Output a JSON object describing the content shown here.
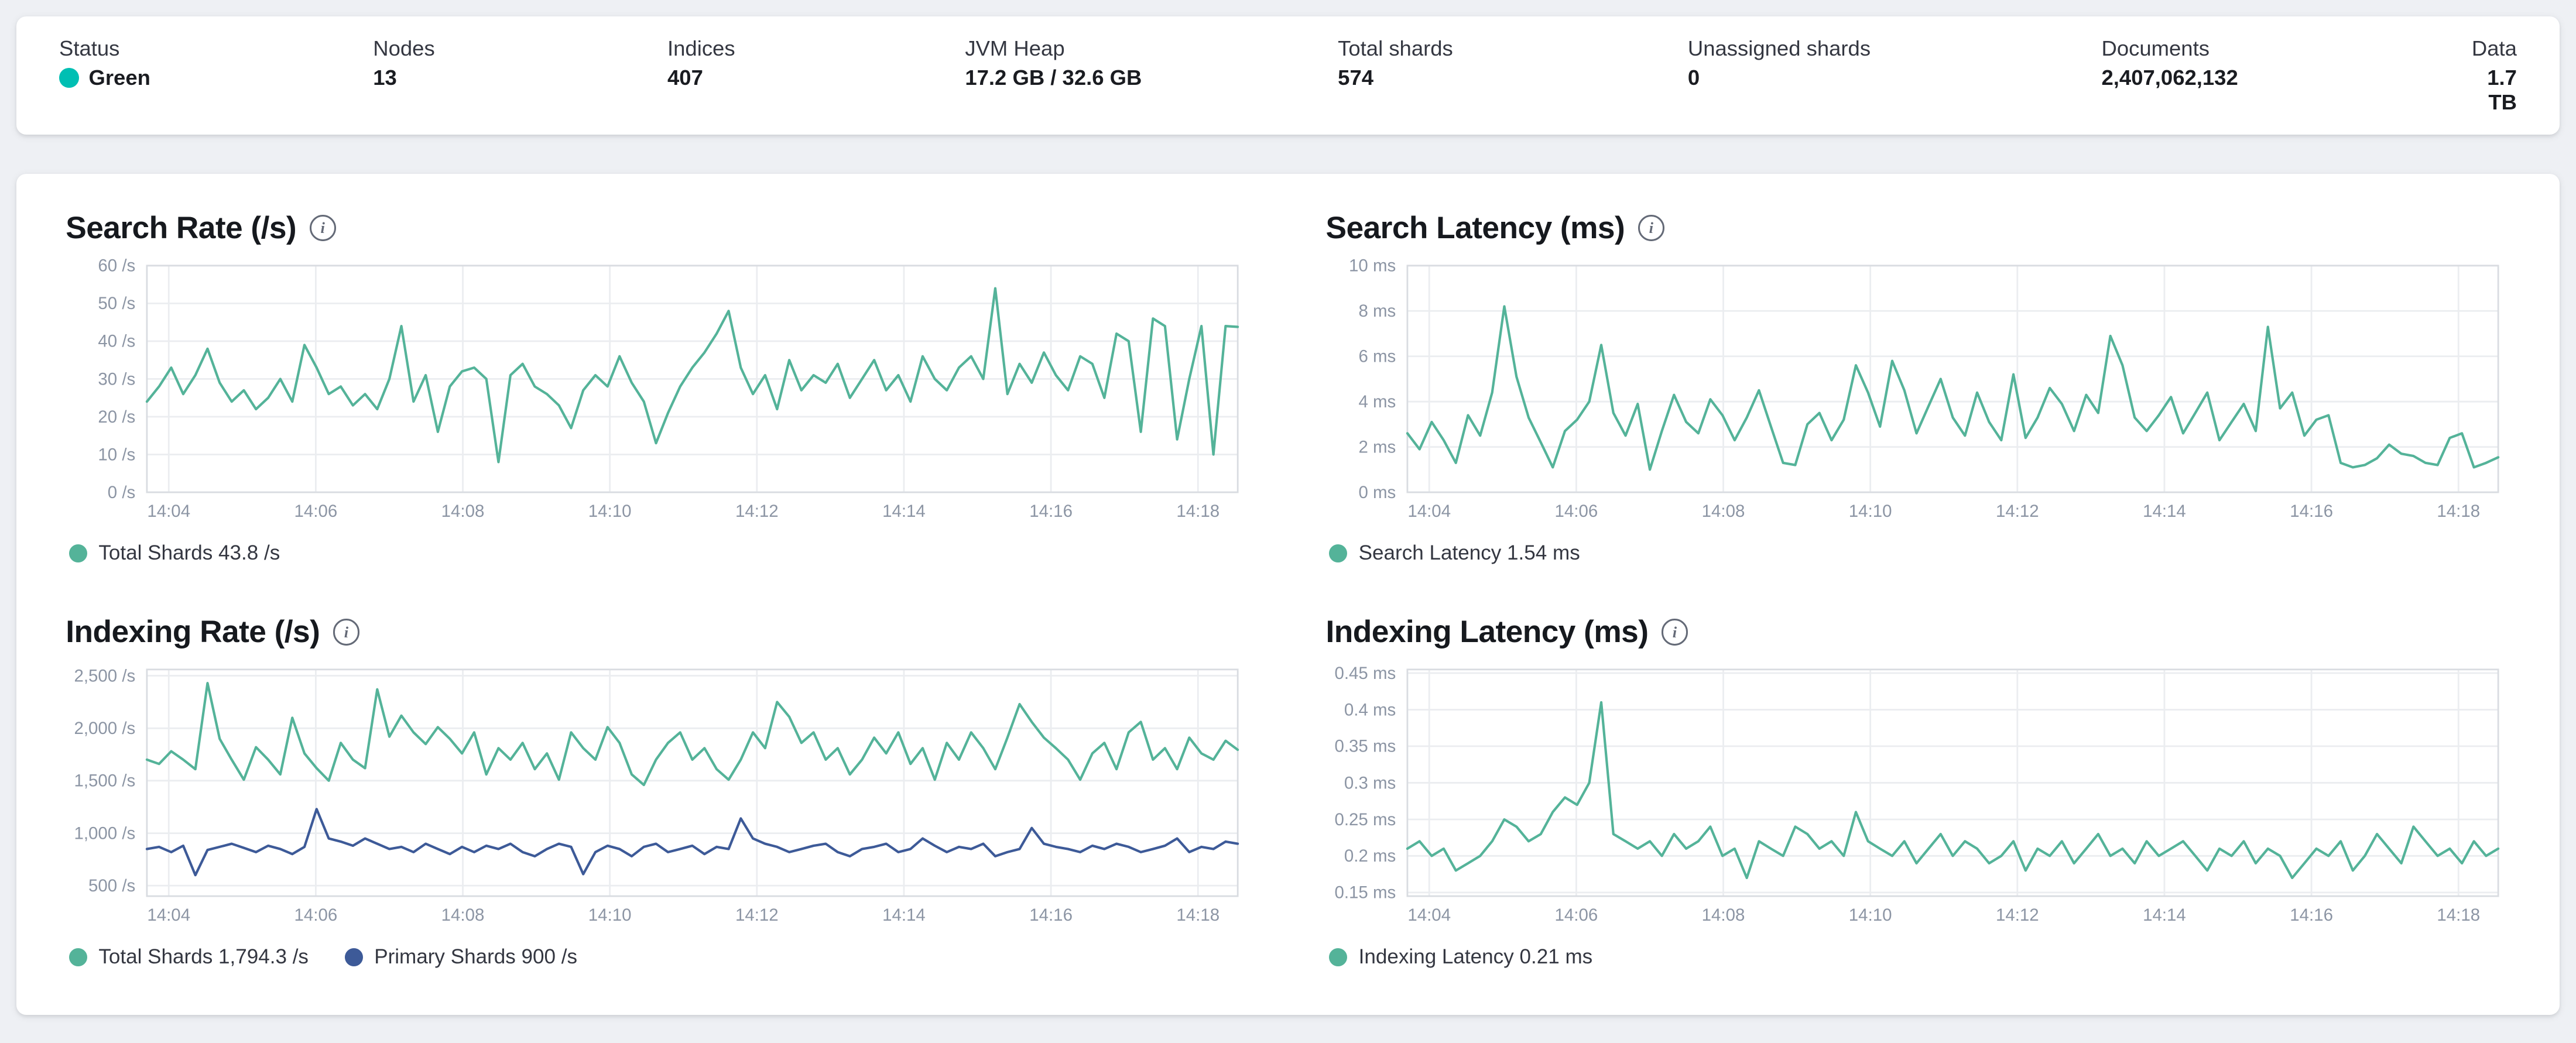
{
  "header": {
    "metrics": [
      {
        "label": "Status",
        "value": "Green",
        "status_color": "#00BFB3"
      },
      {
        "label": "Nodes",
        "value": "13"
      },
      {
        "label": "Indices",
        "value": "407"
      },
      {
        "label": "JVM Heap",
        "value": "17.2 GB / 32.6 GB"
      },
      {
        "label": "Total shards",
        "value": "574"
      },
      {
        "label": "Unassigned shards",
        "value": "0"
      },
      {
        "label": "Documents",
        "value": "2,407,062,132"
      },
      {
        "label": "Data",
        "value": "1.7 TB"
      }
    ]
  },
  "colors": {
    "teal": "#54B399",
    "navy": "#3D5A98",
    "grid": "#ebedf0",
    "border": "#d9dce1"
  },
  "chart_data": [
    {
      "type": "line",
      "title": "Search Rate (/s)",
      "x_ticks": [
        "14:04",
        "14:06",
        "14:08",
        "14:10",
        "14:12",
        "14:14",
        "14:16",
        "14:18"
      ],
      "tick_start_frac": 0.02,
      "tick_step_frac": 0.1348,
      "ylim": [
        0,
        60
      ],
      "y_ticks": [
        {
          "v": 0,
          "label": "0 /s"
        },
        {
          "v": 10,
          "label": "10 /s"
        },
        {
          "v": 20,
          "label": "20 /s"
        },
        {
          "v": 30,
          "label": "30 /s"
        },
        {
          "v": 40,
          "label": "40 /s"
        },
        {
          "v": 50,
          "label": "50 /s"
        },
        {
          "v": 60,
          "label": "60 /s"
        }
      ],
      "series": [
        {
          "name": "Total Shards",
          "color": "#54B399",
          "values": [
            24,
            28,
            33,
            26,
            31,
            38,
            29,
            24,
            27,
            22,
            25,
            30,
            24,
            39,
            33,
            26,
            28,
            23,
            26,
            22,
            30,
            44,
            24,
            31,
            16,
            28,
            32,
            33,
            30,
            8,
            31,
            34,
            28,
            26,
            23,
            17,
            27,
            31,
            28,
            36,
            29,
            24,
            13,
            21,
            28,
            33,
            37,
            42,
            48,
            33,
            26,
            31,
            22,
            35,
            27,
            31,
            29,
            34,
            25,
            30,
            35,
            27,
            31,
            24,
            36,
            30,
            27,
            33,
            36,
            30,
            54,
            26,
            34,
            29,
            37,
            31,
            27,
            36,
            34,
            25,
            42,
            40,
            16,
            46,
            44,
            14,
            30,
            44,
            10,
            44,
            43.8
          ]
        }
      ],
      "legend": [
        {
          "label": "Total Shards 43.8 /s",
          "color": "#54B399"
        }
      ]
    },
    {
      "type": "line",
      "title": "Search Latency (ms)",
      "x_ticks": [
        "14:04",
        "14:06",
        "14:08",
        "14:10",
        "14:12",
        "14:14",
        "14:16",
        "14:18"
      ],
      "tick_start_frac": 0.02,
      "tick_step_frac": 0.1348,
      "ylim": [
        0,
        10
      ],
      "y_ticks": [
        {
          "v": 0,
          "label": "0 ms"
        },
        {
          "v": 2,
          "label": "2 ms"
        },
        {
          "v": 4,
          "label": "4 ms"
        },
        {
          "v": 6,
          "label": "6 ms"
        },
        {
          "v": 8,
          "label": "8 ms"
        },
        {
          "v": 10,
          "label": "10 ms"
        }
      ],
      "series": [
        {
          "name": "Search Latency",
          "color": "#54B399",
          "values": [
            2.6,
            1.9,
            3.1,
            2.3,
            1.3,
            3.4,
            2.5,
            4.4,
            8.2,
            5.1,
            3.3,
            2.2,
            1.1,
            2.7,
            3.2,
            4.0,
            6.5,
            3.5,
            2.5,
            3.9,
            1.0,
            2.7,
            4.3,
            3.1,
            2.6,
            4.1,
            3.4,
            2.3,
            3.3,
            4.5,
            2.9,
            1.3,
            1.2,
            3.0,
            3.5,
            2.3,
            3.2,
            5.6,
            4.4,
            2.9,
            5.8,
            4.5,
            2.6,
            3.8,
            5.0,
            3.3,
            2.5,
            4.4,
            3.1,
            2.3,
            5.2,
            2.4,
            3.3,
            4.6,
            3.9,
            2.7,
            4.3,
            3.5,
            6.9,
            5.6,
            3.3,
            2.7,
            3.4,
            4.2,
            2.6,
            3.5,
            4.4,
            2.3,
            3.1,
            3.9,
            2.7,
            7.3,
            3.7,
            4.4,
            2.5,
            3.2,
            3.4,
            1.3,
            1.1,
            1.2,
            1.5,
            2.1,
            1.7,
            1.6,
            1.3,
            1.2,
            2.4,
            2.6,
            1.1,
            1.3,
            1.54
          ]
        }
      ],
      "legend": [
        {
          "label": "Search Latency 1.54 ms",
          "color": "#54B399"
        }
      ]
    },
    {
      "type": "line",
      "title": "Indexing Rate (/s)",
      "x_ticks": [
        "14:04",
        "14:06",
        "14:08",
        "14:10",
        "14:12",
        "14:14",
        "14:16",
        "14:18"
      ],
      "tick_start_frac": 0.02,
      "tick_step_frac": 0.1348,
      "ylim": [
        400,
        2560
      ],
      "y_ticks": [
        {
          "v": 500,
          "label": "500 /s"
        },
        {
          "v": 1000,
          "label": "1,000 /s"
        },
        {
          "v": 1500,
          "label": "1,500 /s"
        },
        {
          "v": 2000,
          "label": "2,000 /s"
        },
        {
          "v": 2500,
          "label": "2,500 /s"
        }
      ],
      "series": [
        {
          "name": "Total Shards",
          "color": "#54B399",
          "values": [
            1700,
            1660,
            1780,
            1700,
            1610,
            2430,
            1900,
            1700,
            1510,
            1820,
            1700,
            1560,
            2100,
            1760,
            1620,
            1500,
            1860,
            1700,
            1620,
            2370,
            1920,
            2120,
            1960,
            1850,
            2010,
            1900,
            1760,
            1960,
            1560,
            1810,
            1700,
            1860,
            1610,
            1760,
            1510,
            1960,
            1810,
            1700,
            2010,
            1860,
            1560,
            1460,
            1700,
            1860,
            1960,
            1700,
            1810,
            1610,
            1510,
            1700,
            1960,
            1810,
            2250,
            2110,
            1860,
            1960,
            1700,
            1810,
            1560,
            1700,
            1910,
            1760,
            1960,
            1660,
            1810,
            1510,
            1860,
            1700,
            1960,
            1810,
            1610,
            1910,
            2230,
            2060,
            1910,
            1810,
            1700,
            1510,
            1760,
            1860,
            1610,
            1960,
            2060,
            1700,
            1810,
            1610,
            1910,
            1760,
            1700,
            1880,
            1794.3
          ]
        },
        {
          "name": "Primary Shards",
          "color": "#3D5A98",
          "values": [
            850,
            870,
            820,
            880,
            600,
            840,
            870,
            900,
            860,
            820,
            880,
            850,
            800,
            870,
            1230,
            950,
            920,
            880,
            950,
            900,
            850,
            870,
            820,
            900,
            850,
            800,
            870,
            820,
            880,
            850,
            900,
            820,
            780,
            850,
            900,
            870,
            610,
            820,
            880,
            850,
            780,
            870,
            900,
            820,
            850,
            880,
            800,
            870,
            850,
            1140,
            950,
            900,
            870,
            820,
            850,
            880,
            900,
            820,
            780,
            850,
            870,
            900,
            820,
            850,
            950,
            880,
            820,
            870,
            850,
            900,
            780,
            820,
            850,
            1050,
            900,
            870,
            850,
            820,
            880,
            850,
            900,
            870,
            820,
            850,
            880,
            950,
            820,
            870,
            850,
            920,
            900
          ]
        }
      ],
      "legend": [
        {
          "label": "Total Shards 1,794.3 /s",
          "color": "#54B399"
        },
        {
          "label": "Primary Shards 900 /s",
          "color": "#3D5A98"
        }
      ]
    },
    {
      "type": "line",
      "title": "Indexing Latency (ms)",
      "x_ticks": [
        "14:04",
        "14:06",
        "14:08",
        "14:10",
        "14:12",
        "14:14",
        "14:16",
        "14:18"
      ],
      "tick_start_frac": 0.02,
      "tick_step_frac": 0.1348,
      "ylim": [
        0.145,
        0.455
      ],
      "y_ticks": [
        {
          "v": 0.15,
          "label": "0.15 ms"
        },
        {
          "v": 0.2,
          "label": "0.2 ms"
        },
        {
          "v": 0.25,
          "label": "0.25 ms"
        },
        {
          "v": 0.3,
          "label": "0.3 ms"
        },
        {
          "v": 0.35,
          "label": "0.35 ms"
        },
        {
          "v": 0.4,
          "label": "0.4 ms"
        },
        {
          "v": 0.45,
          "label": "0.45 ms"
        }
      ],
      "series": [
        {
          "name": "Indexing Latency",
          "color": "#54B399",
          "values": [
            0.21,
            0.22,
            0.2,
            0.21,
            0.18,
            0.19,
            0.2,
            0.22,
            0.25,
            0.24,
            0.22,
            0.23,
            0.26,
            0.28,
            0.27,
            0.3,
            0.41,
            0.23,
            0.22,
            0.21,
            0.22,
            0.2,
            0.23,
            0.21,
            0.22,
            0.24,
            0.2,
            0.21,
            0.17,
            0.22,
            0.21,
            0.2,
            0.24,
            0.23,
            0.21,
            0.22,
            0.2,
            0.26,
            0.22,
            0.21,
            0.2,
            0.22,
            0.19,
            0.21,
            0.23,
            0.2,
            0.22,
            0.21,
            0.19,
            0.2,
            0.22,
            0.18,
            0.21,
            0.2,
            0.22,
            0.19,
            0.21,
            0.23,
            0.2,
            0.21,
            0.19,
            0.22,
            0.2,
            0.21,
            0.22,
            0.2,
            0.18,
            0.21,
            0.2,
            0.22,
            0.19,
            0.21,
            0.2,
            0.17,
            0.19,
            0.21,
            0.2,
            0.22,
            0.18,
            0.2,
            0.23,
            0.21,
            0.19,
            0.24,
            0.22,
            0.2,
            0.21,
            0.19,
            0.22,
            0.2,
            0.21
          ]
        }
      ],
      "legend": [
        {
          "label": "Indexing Latency 0.21 ms",
          "color": "#54B399"
        }
      ]
    }
  ]
}
